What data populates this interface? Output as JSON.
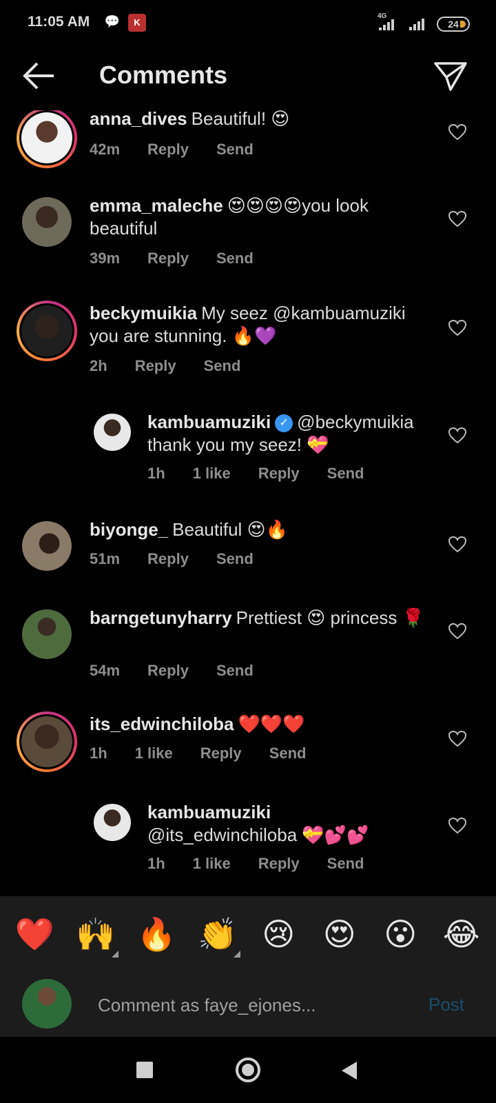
{
  "status_bar": {
    "time": "11:05 AM",
    "network": "4G",
    "battery": "24",
    "icons": [
      "chat-bubble-icon",
      "shop-icon",
      "signal-icon",
      "signal-icon",
      "battery-icon"
    ]
  },
  "header": {
    "title": "Comments",
    "back_icon": "arrow-left-icon",
    "share_icon": "paper-plane-icon"
  },
  "comments": [
    {
      "user": "anna_dives",
      "text": "Beautiful! 😍",
      "time": "42m",
      "likes": "",
      "reply": "Reply",
      "send": "Send",
      "story_ring": true
    },
    {
      "user": "emma_maleche",
      "text": "😍😍😍😍you look beautiful",
      "time": "39m",
      "likes": "",
      "reply": "Reply",
      "send": "Send",
      "story_ring": false
    },
    {
      "user": "beckymuikia",
      "text": "My seez @kambuamuziki you are stunning. 🔥💜",
      "time": "2h",
      "likes": "",
      "reply": "Reply",
      "send": "Send",
      "story_ring": true
    },
    {
      "user": "kambuamuziki",
      "verified": true,
      "text": "@beckymuikia thank you my seez! 💝",
      "time": "1h",
      "likes": "1 like",
      "reply": "Reply",
      "send": "Send",
      "story_ring": false,
      "is_reply": true
    },
    {
      "user": "biyonge_",
      "text": "Beautiful 😍🔥",
      "time": "51m",
      "likes": "",
      "reply": "Reply",
      "send": "Send",
      "story_ring": false
    },
    {
      "user": "barngetunyharry",
      "text": "Prettiest 😍 princess 🌹",
      "time": "54m",
      "likes": "",
      "reply": "Reply",
      "send": "Send",
      "story_ring": false
    },
    {
      "user": "its_edwinchiloba",
      "text": "❤️❤️❤️",
      "time": "1h",
      "likes": "1 like",
      "reply": "Reply",
      "send": "Send",
      "story_ring": true
    },
    {
      "user": "kambuamuziki",
      "verified": false,
      "text": "@its_edwinchiloba 💝💕💕",
      "time": "1h",
      "likes": "1 like",
      "reply": "Reply",
      "send": "Send",
      "story_ring": false,
      "is_reply": true
    }
  ],
  "emoji_bar": [
    "❤️",
    "🙌",
    "🔥",
    "👏",
    "😢",
    "😍",
    "😮",
    "😂"
  ],
  "composer": {
    "placeholder": "Comment as faye_ejones...",
    "post_label": "Post"
  },
  "colors": {
    "background": "#000000",
    "muted_text": "#8e8e8e",
    "verified_blue": "#3897f0",
    "post_disabled": "#1a4d6e"
  }
}
